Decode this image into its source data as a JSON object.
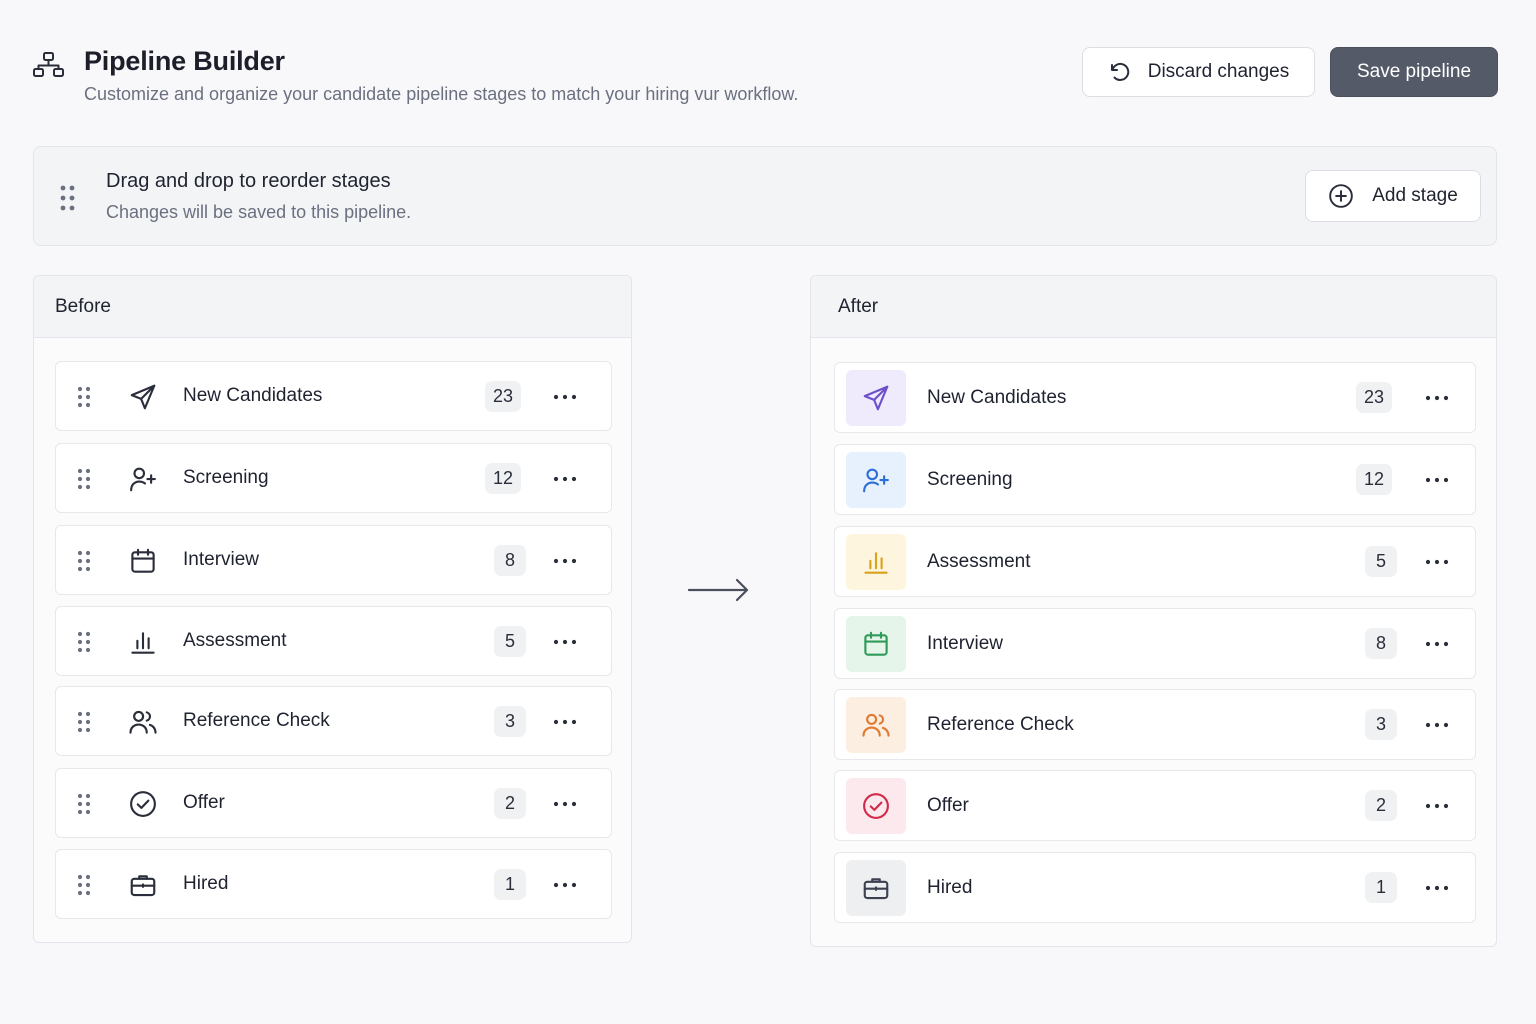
{
  "header": {
    "title": "Pipeline Builder",
    "subtitle": "Customize and organize your candidate pipeline stages to match your hiring vur workflow.",
    "discard_label": "Discard changes",
    "save_label": "Save pipeline"
  },
  "infobar": {
    "title": "Drag and drop to reorder stages",
    "subtitle": "Changes will be saved to this pipeline.",
    "add_label": "Add stage"
  },
  "before": {
    "title": "Before",
    "stages": [
      {
        "label": "New Candidates",
        "count": "23",
        "icon": "send-icon"
      },
      {
        "label": "Screening",
        "count": "12",
        "icon": "user-plus-icon"
      },
      {
        "label": "Interview",
        "count": "8",
        "icon": "calendar-icon"
      },
      {
        "label": "Assessment",
        "count": "5",
        "icon": "bar-chart-icon"
      },
      {
        "label": "Reference Check",
        "count": "3",
        "icon": "users-icon"
      },
      {
        "label": "Offer",
        "count": "2",
        "icon": "check-circle-icon"
      },
      {
        "label": "Hired",
        "count": "1",
        "icon": "briefcase-icon"
      }
    ]
  },
  "after": {
    "title": "After",
    "stages": [
      {
        "label": "New Candidates",
        "count": "23",
        "icon": "send-icon",
        "color": "#6d4fc9",
        "bg": "#efeafc"
      },
      {
        "label": "Screening",
        "count": "12",
        "icon": "user-plus-icon",
        "color": "#2d6fd6",
        "bg": "#e7f0fd"
      },
      {
        "label": "Assessment",
        "count": "5",
        "icon": "bar-chart-icon",
        "color": "#d9a21b",
        "bg": "#fdf5de"
      },
      {
        "label": "Interview",
        "count": "8",
        "icon": "calendar-icon",
        "color": "#2f9a5a",
        "bg": "#e5f5ea"
      },
      {
        "label": "Reference Check",
        "count": "3",
        "icon": "users-icon",
        "color": "#e07a30",
        "bg": "#fdeee2"
      },
      {
        "label": "Offer",
        "count": "2",
        "icon": "check-circle-icon",
        "color": "#d22a4a",
        "bg": "#fce9ed"
      },
      {
        "label": "Hired",
        "count": "1",
        "icon": "briefcase-icon",
        "color": "#3c4150",
        "bg": "#eeeff1"
      }
    ]
  }
}
